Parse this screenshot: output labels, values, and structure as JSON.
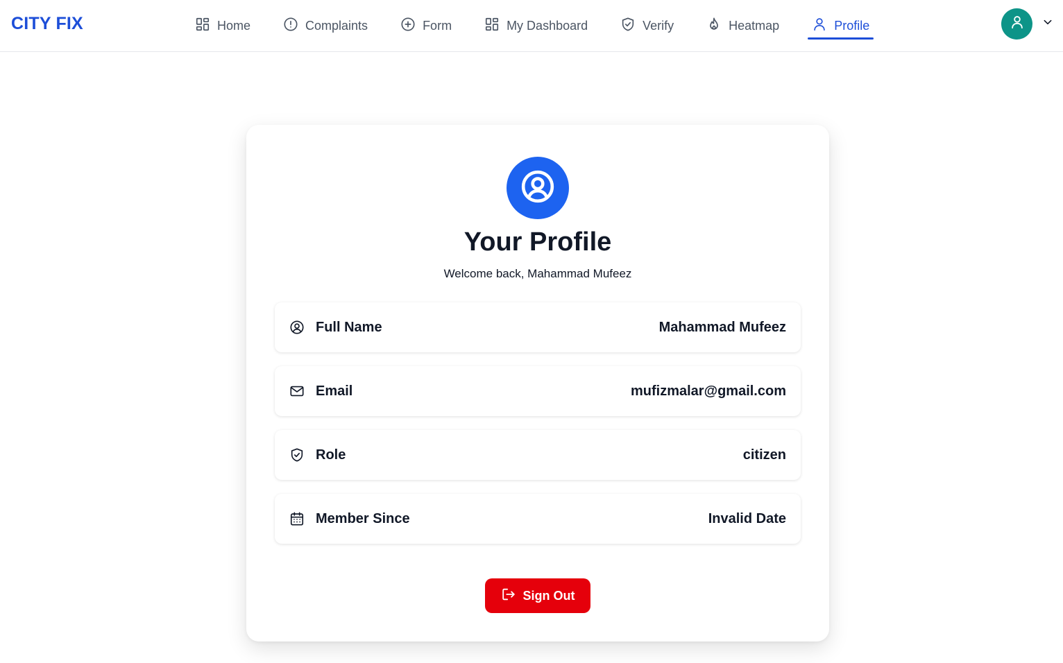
{
  "brand": "CITY FIX",
  "nav": {
    "items": [
      {
        "label": "Home",
        "icon": "grid-icon",
        "active": false
      },
      {
        "label": "Complaints",
        "icon": "alert-circle-icon",
        "active": false
      },
      {
        "label": "Form",
        "icon": "plus-circle-icon",
        "active": false
      },
      {
        "label": "My Dashboard",
        "icon": "grid-icon",
        "active": false
      },
      {
        "label": "Verify",
        "icon": "shield-check-icon",
        "active": false
      },
      {
        "label": "Heatmap",
        "icon": "flame-icon",
        "active": false
      },
      {
        "label": "Profile",
        "icon": "user-icon",
        "active": true
      }
    ]
  },
  "user_menu": {
    "avatar_icon": "user-icon",
    "avatar_color": "#0d9488",
    "dropdown_icon": "chevron-down-icon"
  },
  "profile": {
    "badge_icon": "user-circle-icon",
    "badge_color": "#1d63f0",
    "title": "Your Profile",
    "welcome": "Welcome back, Mahammad Mufeez",
    "fields": [
      {
        "icon": "user-circle-icon",
        "label": "Full Name",
        "value": "Mahammad Mufeez"
      },
      {
        "icon": "mail-icon",
        "label": "Email",
        "value": "mufizmalar@gmail.com"
      },
      {
        "icon": "shield-check-icon",
        "label": "Role",
        "value": "citizen"
      },
      {
        "icon": "calendar-icon",
        "label": "Member Since",
        "value": "Invalid Date"
      }
    ],
    "sign_out_label": "Sign Out",
    "sign_out_icon": "log-out-icon",
    "sign_out_color": "#e5000b"
  },
  "colors": {
    "accent": "#1d4ed8",
    "nav_text": "#4b5563"
  }
}
